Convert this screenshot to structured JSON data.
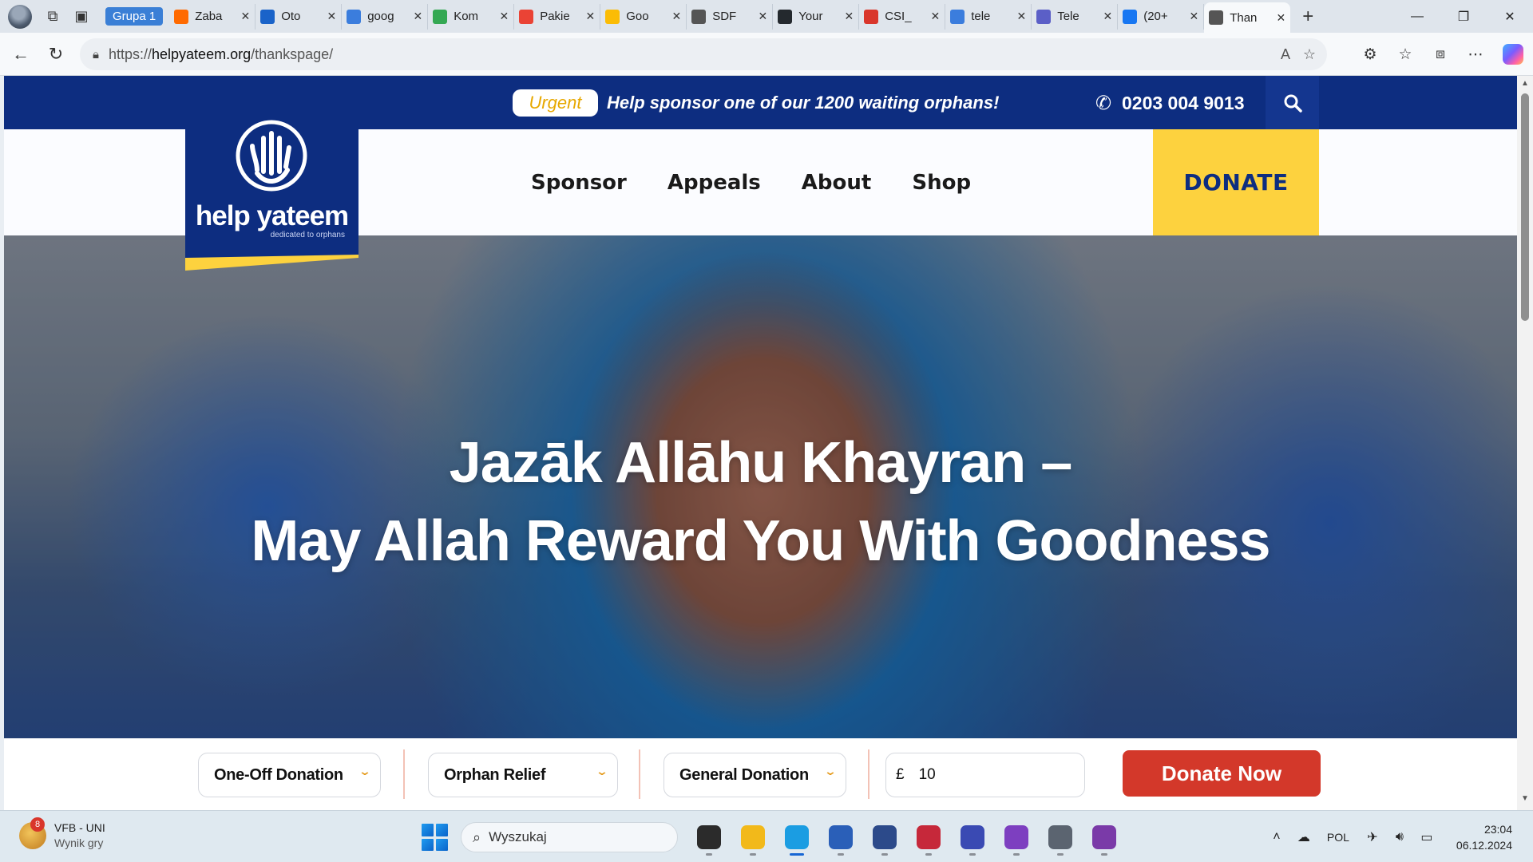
{
  "browser": {
    "tab_group": "Grupa 1",
    "tabs": [
      {
        "label": "Zaba",
        "icon": "amazon-icon",
        "color": "#ff6a00"
      },
      {
        "label": "Oto",
        "icon": "gk-icon",
        "color": "#1a63c9"
      },
      {
        "label": "goog",
        "icon": "search-icon",
        "color": "#3b7ddd"
      },
      {
        "label": "Kom",
        "icon": "google-drive-icon",
        "color": "#34a853"
      },
      {
        "label": "Pakie",
        "icon": "google-maps-icon",
        "color": "#ea4335"
      },
      {
        "label": "Goo",
        "icon": "google-maps-icon",
        "color": "#fbbc05"
      },
      {
        "label": "SDF",
        "icon": "globe-icon",
        "color": "#555555"
      },
      {
        "label": "Your",
        "icon": "github-icon",
        "color": "#24292e"
      },
      {
        "label": "CSI_",
        "icon": "pdf-icon",
        "color": "#d9362b"
      },
      {
        "label": "tele",
        "icon": "search-icon",
        "color": "#3b7ddd"
      },
      {
        "label": "Tele",
        "icon": "teams-icon",
        "color": "#5b5fc7"
      },
      {
        "label": "(20+",
        "icon": "facebook-icon",
        "color": "#1877f2"
      },
      {
        "label": "Than",
        "icon": "globe-icon",
        "color": "#555555",
        "active": true
      }
    ],
    "url_prefix": "https://",
    "url_domain": "helpyateem.org",
    "url_path": "/thankspage/"
  },
  "site": {
    "urgent_badge": "Urgent",
    "urgent_text": "Help sponsor one of our 1200 waiting orphans!",
    "phone": "0203 004 9013",
    "logo_name": "help yateem",
    "logo_tagline": "dedicated to orphans",
    "nav": [
      "Sponsor",
      "Appeals",
      "About",
      "Shop"
    ],
    "donate_header": "DONATE",
    "hero_line1": "Jazāk Allāhu Khayran –",
    "hero_line2": "May Allah Reward You With Goodness",
    "donation_form": {
      "frequency": "One-Off Donation",
      "appeal": "Orphan Relief",
      "type": "General Donation",
      "currency": "£",
      "amount": "10",
      "submit": "Donate Now"
    },
    "colors": {
      "brand_blue": "#0d2d80",
      "brand_yellow": "#fdd23e",
      "cta_red": "#d3382a",
      "urgent_orange": "#e7a800"
    }
  },
  "taskbar": {
    "widget_badge": "8",
    "widget_title": "VFB - UNI",
    "widget_subtitle": "Wynik gry",
    "search_placeholder": "Wyszukaj",
    "apps": [
      {
        "name": "task-view-icon",
        "color": "#2b2b2b"
      },
      {
        "name": "file-explorer-icon",
        "color": "#f2b91a"
      },
      {
        "name": "edge-icon",
        "color": "#1b9de2",
        "active": true
      },
      {
        "name": "store-icon",
        "color": "#2a5fb8"
      },
      {
        "name": "virtualbox-icon",
        "color": "#2c4a8a"
      },
      {
        "name": "app-red-icon",
        "color": "#c6283a"
      },
      {
        "name": "save-disk-icon",
        "color": "#3a4ab3"
      },
      {
        "name": "tor-icon",
        "color": "#7d3fc0"
      },
      {
        "name": "settings-icon",
        "color": "#5b6470"
      },
      {
        "name": "github-desktop-icon",
        "color": "#7a3aa8"
      }
    ],
    "language": "POL",
    "time": "23:04",
    "date": "06.12.2024"
  }
}
